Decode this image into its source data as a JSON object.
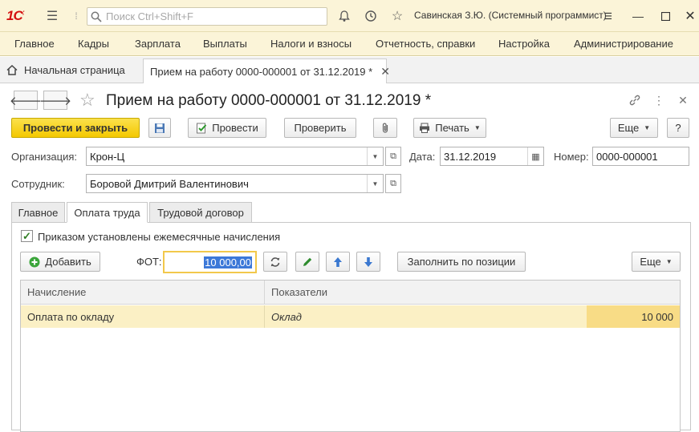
{
  "app": {
    "search_placeholder": "Поиск Ctrl+Shift+F",
    "user": "Савинская З.Ю. (Системный программист)"
  },
  "menu": [
    "Главное",
    "Кадры",
    "Зарплата",
    "Выплаты",
    "Налоги и взносы",
    "Отчетность, справки",
    "Настройка",
    "Администрирование"
  ],
  "tabs": {
    "home": "Начальная страница",
    "doc": "Прием на работу 0000-000001 от 31.12.2019 *"
  },
  "form": {
    "title": "Прием на работу 0000-000001 от 31.12.2019 *",
    "buttons": {
      "post_close": "Провести и закрыть",
      "post": "Провести",
      "check": "Проверить",
      "print": "Печать",
      "more": "Еще",
      "help": "?"
    },
    "org_label": "Организация:",
    "org_value": "Крон-Ц",
    "date_label": "Дата:",
    "date_value": "31.12.2019",
    "num_label": "Номер:",
    "num_value": "0000-000001",
    "emp_label": "Сотрудник:",
    "emp_value": "Боровой Дмитрий Валентинович"
  },
  "inner_tabs": [
    "Главное",
    "Оплата труда",
    "Трудовой договор"
  ],
  "pay": {
    "checkbox_label": "Приказом установлены ежемесячные начисления",
    "checked": true,
    "add": "Добавить",
    "fot_label": "ФОТ:",
    "fot_value": "10 000,00",
    "fill_by_position": "Заполнить по позиции",
    "more": "Еще"
  },
  "table": {
    "columns": [
      "Начисление",
      "Показатели"
    ],
    "rows": [
      {
        "accrual": "Оплата по окладу",
        "indicator": "Оклад",
        "value": "10 000"
      }
    ]
  },
  "colors": {
    "accent_yellow": "#f4c800",
    "header_bg": "#fbf4d8",
    "row_highlight": "#fbf0c5",
    "selection_blue": "#3c78d8"
  }
}
